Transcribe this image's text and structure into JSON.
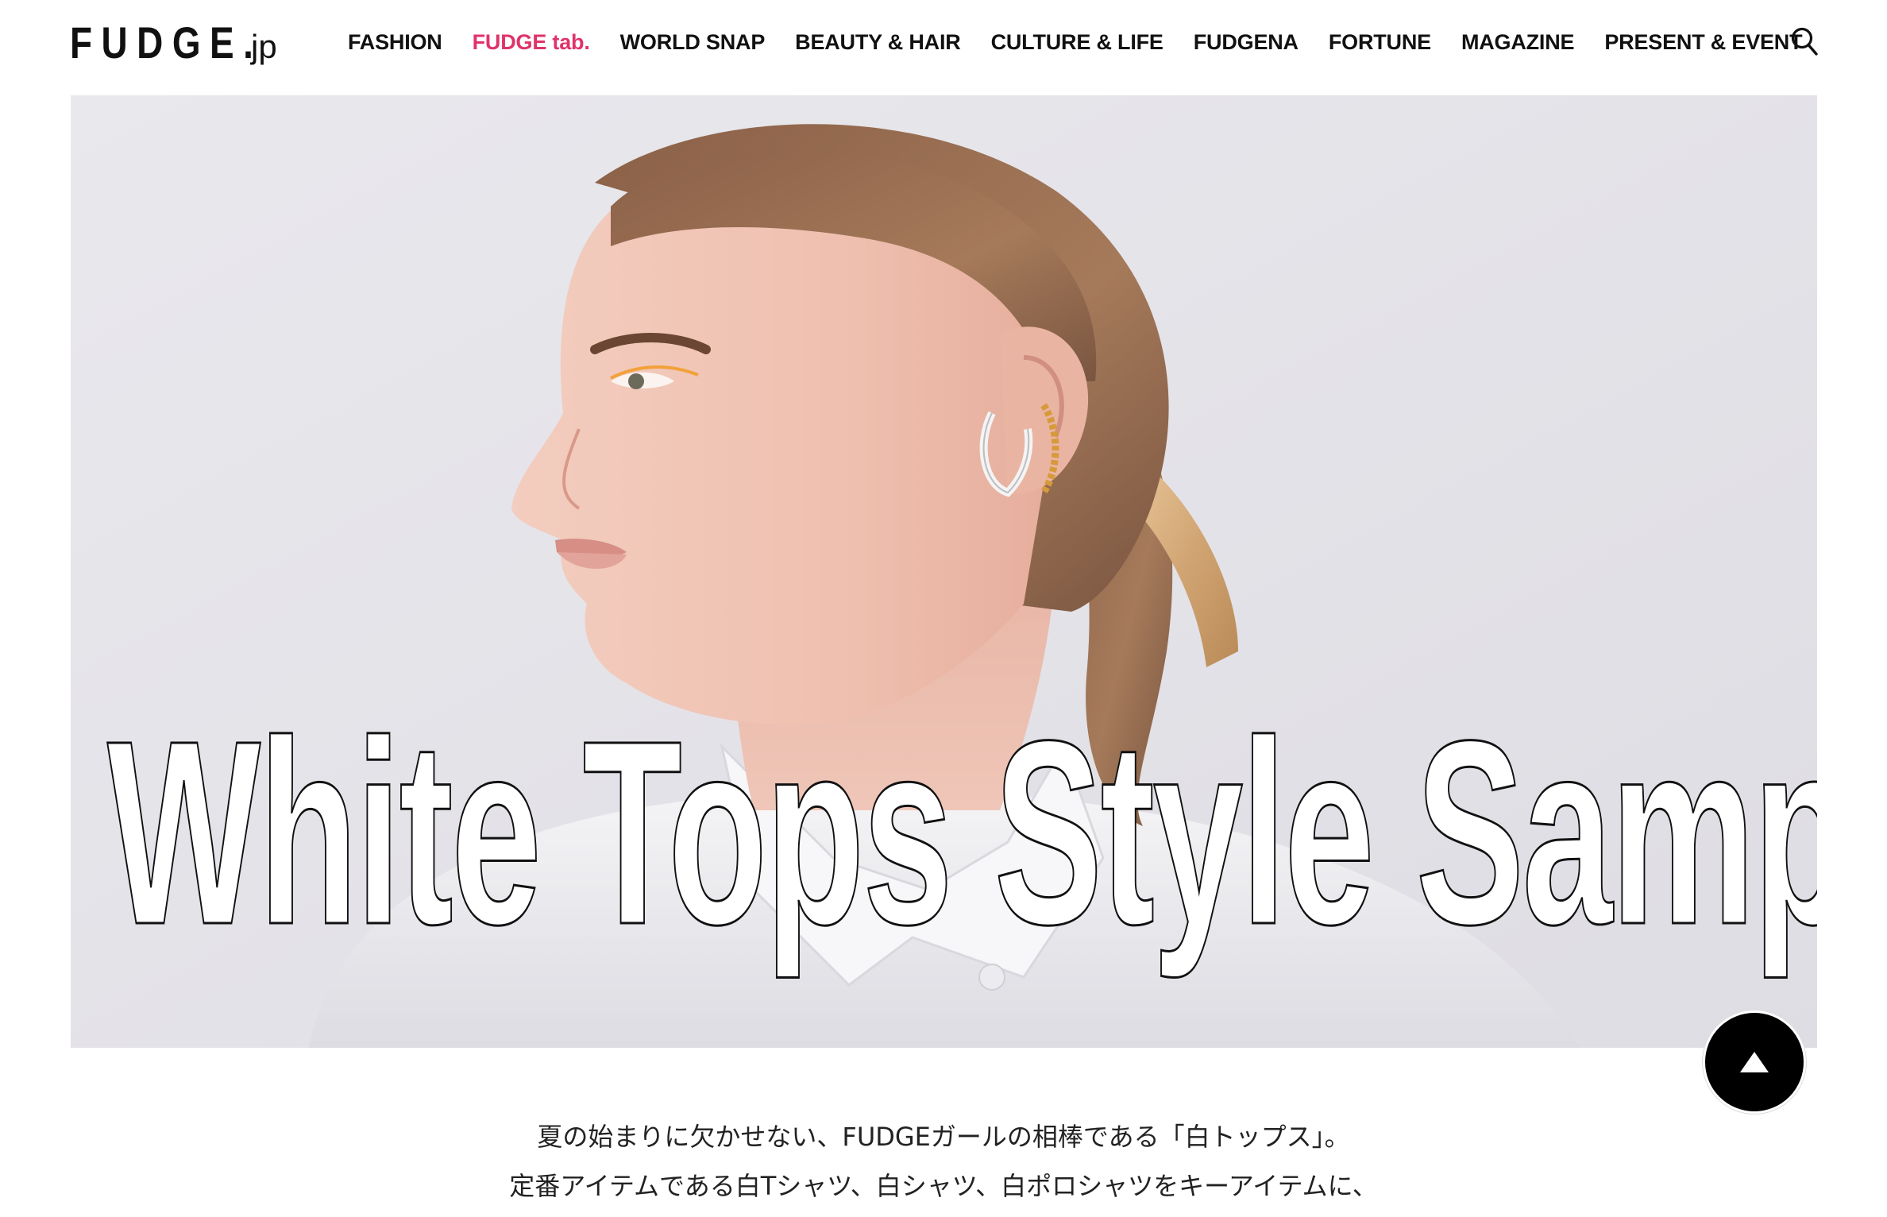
{
  "header": {
    "logo_main": "FUDGE.",
    "logo_suffix": "jp",
    "nav": [
      {
        "label": "FASHION",
        "active": false
      },
      {
        "label": "FUDGE tab.",
        "active": true
      },
      {
        "label": "WORLD SNAP",
        "active": false
      },
      {
        "label": "BEAUTY & HAIR",
        "active": false
      },
      {
        "label": "CULTURE & LIFE",
        "active": false
      },
      {
        "label": "FUDGENA",
        "active": false
      },
      {
        "label": "FORTUNE",
        "active": false
      },
      {
        "label": "MAGAZINE",
        "active": false
      },
      {
        "label": "PRESENT & EVENT",
        "active": false
      }
    ],
    "search_icon": "search-icon"
  },
  "hero": {
    "title": "White Tops Style Sample"
  },
  "back_to_top_icon": "triangle-up-icon",
  "intro": {
    "line1": "夏の始まりに欠かせない、FUDGEガールの相棒である「白トップス」。",
    "line2": "定番アイテムである白Tシャツ、白シャツ、白ポロシャツをキーアイテムに、"
  },
  "colors": {
    "accent": "#e0336b",
    "text": "#111111",
    "hero_bg": "#e6e5ea"
  }
}
